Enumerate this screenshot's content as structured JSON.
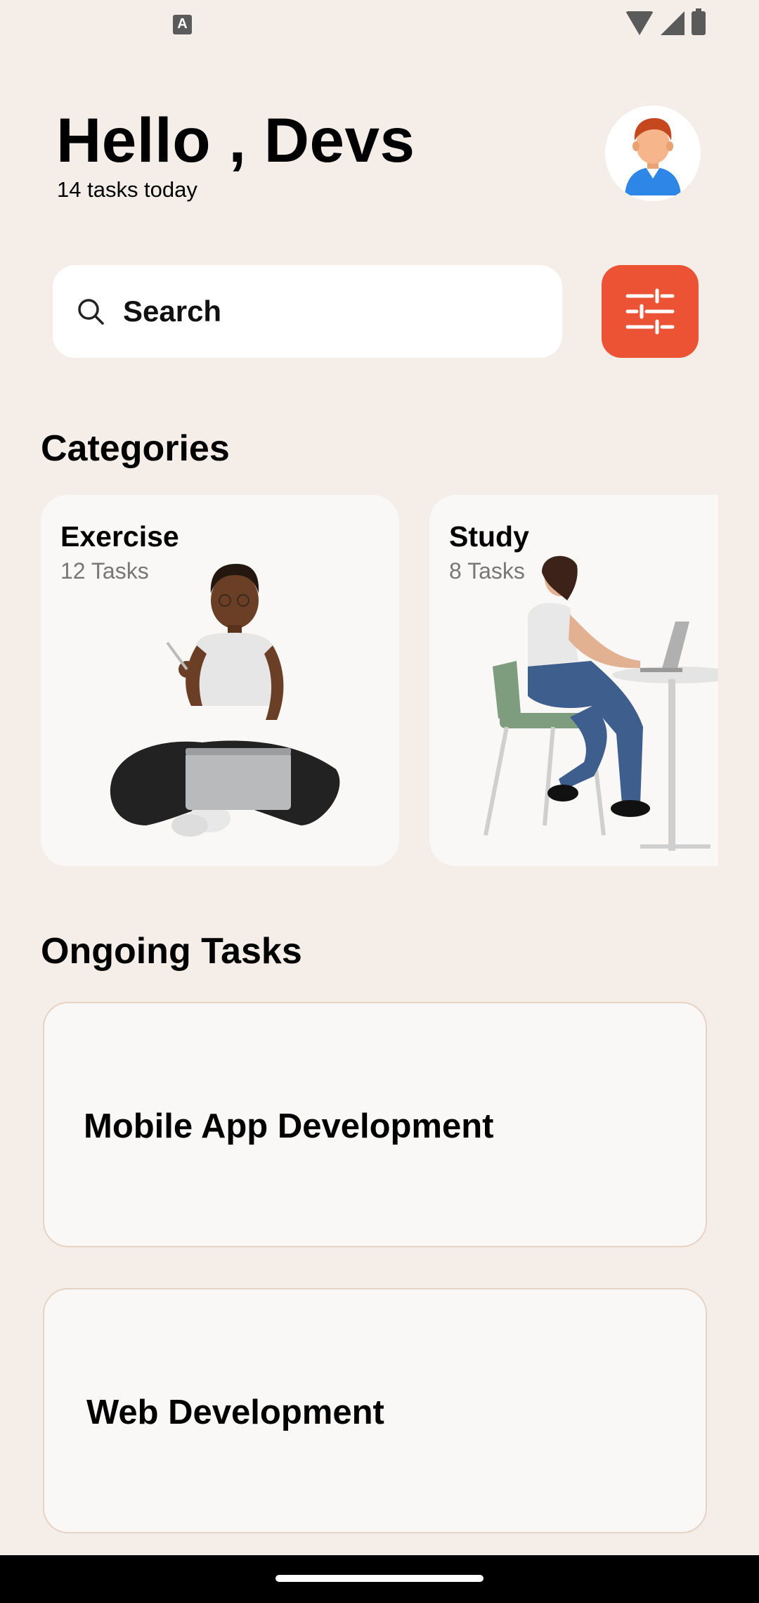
{
  "status_bar": {
    "notification_badge": "A",
    "icons": [
      "wifi-icon",
      "signal-icon",
      "battery-icon"
    ]
  },
  "header": {
    "greeting": "Hello , Devs",
    "subtitle": "14 tasks today",
    "avatar_icon": "user-avatar-icon"
  },
  "search": {
    "placeholder": "Search",
    "filter_icon": "sliders-icon"
  },
  "categories": {
    "title": "Categories",
    "items": [
      {
        "name": "Exercise",
        "count": "12 Tasks"
      },
      {
        "name": "Study",
        "count": "8 Tasks"
      }
    ]
  },
  "ongoing": {
    "title": "Ongoing Tasks",
    "tasks": [
      {
        "title": "Mobile App Development"
      },
      {
        "title": "Web Development"
      }
    ]
  },
  "colors": {
    "background": "#F5EEE8",
    "accent": "#EC5234",
    "card": "#F9F8F6",
    "task_border": "#E7D3C5"
  }
}
